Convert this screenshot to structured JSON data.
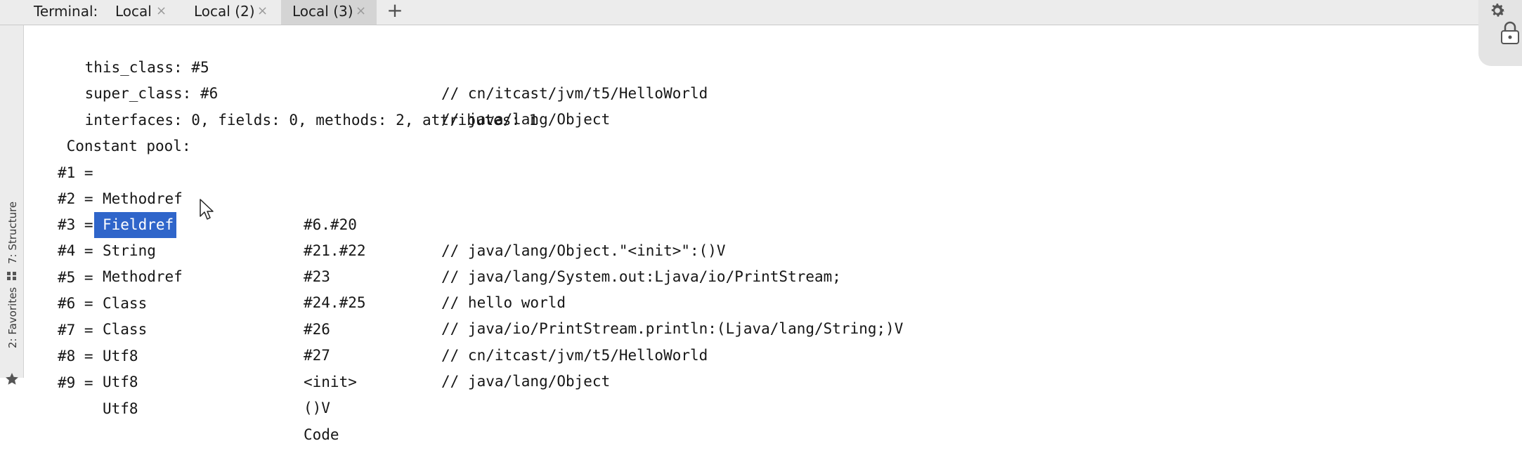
{
  "tabs": {
    "prefix": "Terminal:",
    "items": [
      {
        "label": "Local",
        "close": "×"
      },
      {
        "label": "Local (2)",
        "close": "×"
      },
      {
        "label": "Local (3)",
        "close": "×"
      }
    ],
    "add": "+"
  },
  "toolwindows": {
    "structure": "7: Structure",
    "favorites": "2: Favorites"
  },
  "terminal": {
    "header": [
      {
        "left": "this_class: #5",
        "comment": "// cn/itcast/jvm/t5/HelloWorld"
      },
      {
        "left": "super_class: #6",
        "comment": "// java/lang/Object"
      },
      {
        "left": "interfaces: 0, fields: 0, methods: 2, attributes: 1",
        "comment": ""
      }
    ],
    "pool_title": "Constant pool:",
    "entries": [
      {
        "idx": "#1 =",
        "type": "Methodref",
        "ref": "#6.#20",
        "comment": "// java/lang/Object.\"<init>\":()V"
      },
      {
        "idx": "#2 =",
        "type": "Fieldref",
        "ref": "#21.#22",
        "comment": "// java/lang/System.out:Ljava/io/PrintStream;"
      },
      {
        "idx": "#3 =",
        "type": "String",
        "ref": "#23",
        "comment": "// hello world"
      },
      {
        "idx": "#4 =",
        "type": "Methodref",
        "ref": "#24.#25",
        "comment": "// java/io/PrintStream.println:(Ljava/lang/String;)V"
      },
      {
        "idx": "#5 =",
        "type": "Class",
        "ref": "#26",
        "comment": "// cn/itcast/jvm/t5/HelloWorld"
      },
      {
        "idx": "#6 =",
        "type": "Class",
        "ref": "#27",
        "comment": "// java/lang/Object"
      },
      {
        "idx": "#7 =",
        "type": "Utf8",
        "ref": "<init>",
        "comment": ""
      },
      {
        "idx": "#8 =",
        "type": "Utf8",
        "ref": "()V",
        "comment": ""
      },
      {
        "idx": "#9 =",
        "type": "Utf8",
        "ref": "Code",
        "comment": ""
      }
    ],
    "selected_text": "Fieldref",
    "colors": {
      "selection": "#2f65ca",
      "text": "#161616"
    }
  }
}
